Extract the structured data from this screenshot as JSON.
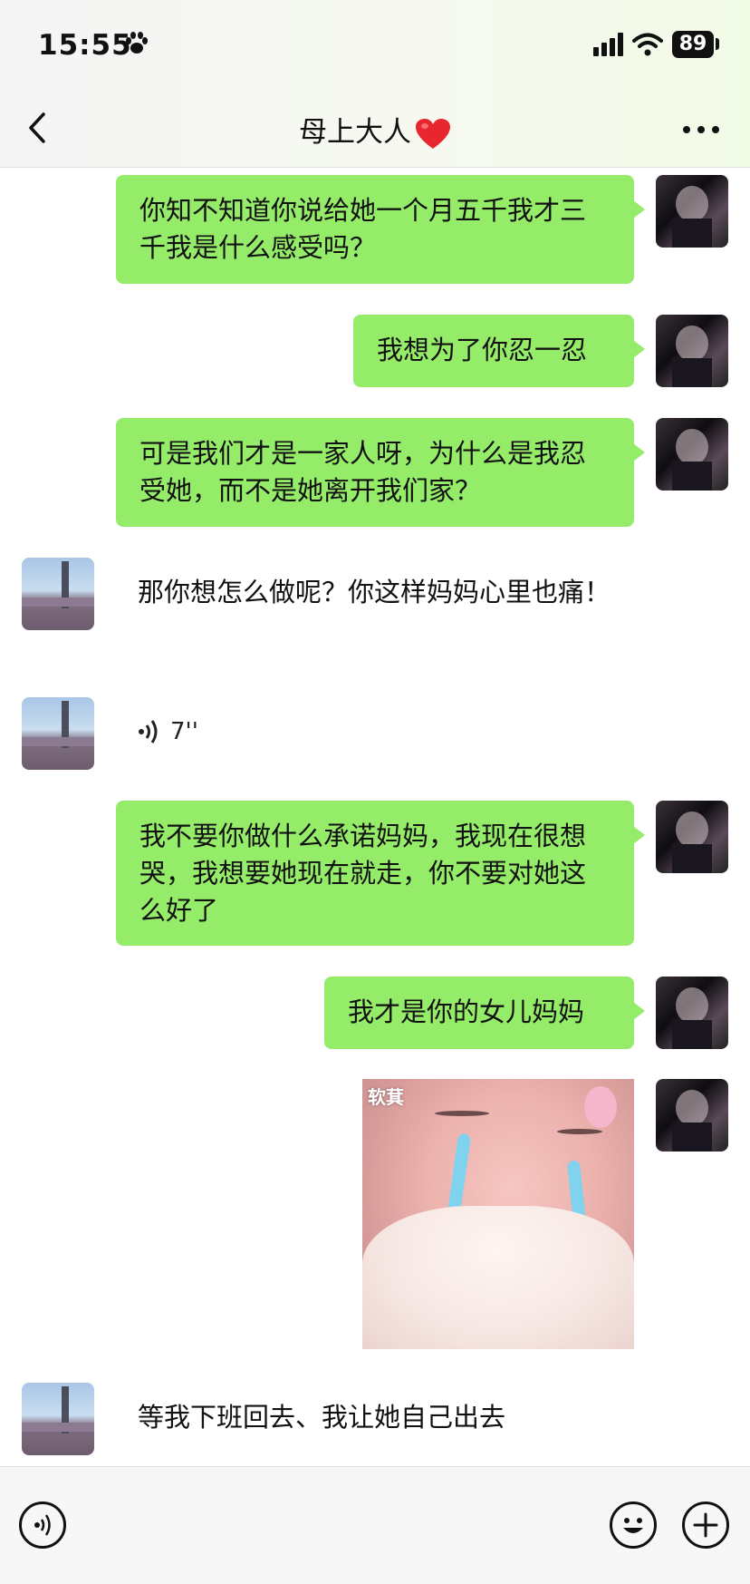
{
  "status": {
    "time": "15:55",
    "battery": "89"
  },
  "nav": {
    "title": "母上大人"
  },
  "messages": [
    {
      "side": "right",
      "text": "你知不知道你说给她一个月五千我才三千我是什么感受吗？"
    },
    {
      "side": "right",
      "text": "我想为了你忍一忍"
    },
    {
      "side": "right",
      "text": "可是我们才是一家人呀，为什么是我忍受她，而不是她离开我们家？"
    },
    {
      "side": "left",
      "text": "那你想怎么做呢？你这样妈妈心里也痛！"
    },
    {
      "side": "left",
      "type": "voice",
      "duration": "7''"
    },
    {
      "side": "right",
      "text": "我不要你做什么承诺妈妈，我现在很想哭，我想要她现在就走，你不要对她这么好了"
    },
    {
      "side": "right",
      "text": "我才是你的女儿妈妈"
    },
    {
      "side": "right",
      "type": "sticker",
      "caption": "软萁"
    },
    {
      "side": "left",
      "text": "等我下班回去、我让她自己出去"
    }
  ],
  "icons": {
    "status": [
      "paw-icon",
      "signal-icon",
      "wifi-icon",
      "battery-icon"
    ],
    "nav": [
      "back-icon",
      "heart-icon",
      "more-icon"
    ],
    "input": [
      "voice-input-icon",
      "emoji-icon",
      "plus-icon"
    ]
  },
  "colors": {
    "bubble_self": "#95ec69",
    "background": "#ffffff"
  }
}
